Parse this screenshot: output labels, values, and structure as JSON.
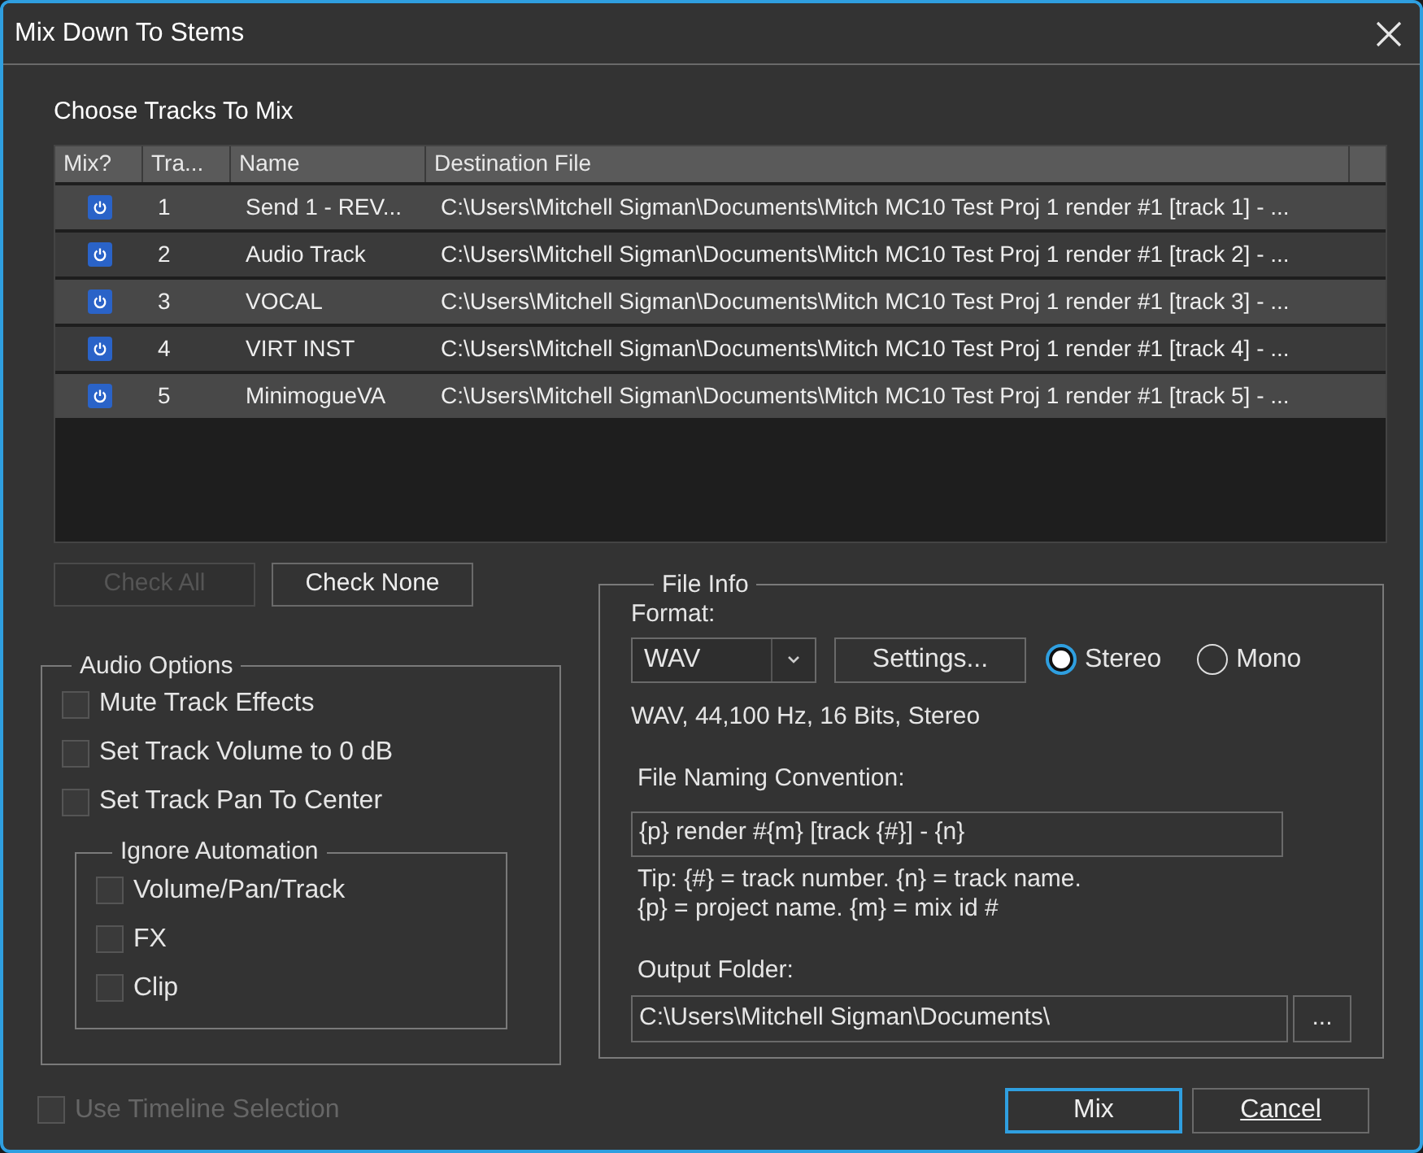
{
  "window": {
    "title": "Mix Down To Stems"
  },
  "tracks": {
    "title": "Choose Tracks To Mix",
    "columns": [
      "Mix?",
      "Tra...",
      "Name",
      "Destination File"
    ],
    "rows": [
      {
        "mix": true,
        "number": "1",
        "name": "Send 1 - REV...",
        "destination": "C:\\Users\\Mitchell Sigman\\Documents\\Mitch MC10 Test Proj 1 render #1 [track 1] - ..."
      },
      {
        "mix": true,
        "number": "2",
        "name": "Audio Track",
        "destination": "C:\\Users\\Mitchell Sigman\\Documents\\Mitch MC10 Test Proj 1 render #1 [track 2] - ..."
      },
      {
        "mix": true,
        "number": "3",
        "name": "VOCAL",
        "destination": "C:\\Users\\Mitchell Sigman\\Documents\\Mitch MC10 Test Proj 1 render #1 [track 3] - ..."
      },
      {
        "mix": true,
        "number": "4",
        "name": "VIRT INST",
        "destination": "C:\\Users\\Mitchell Sigman\\Documents\\Mitch MC10 Test Proj 1 render #1 [track 4] - ..."
      },
      {
        "mix": true,
        "number": "5",
        "name": "MinimogueVA",
        "destination": "C:\\Users\\Mitchell Sigman\\Documents\\Mitch MC10 Test Proj 1 render #1 [track 5] - ..."
      }
    ]
  },
  "check_buttons": [
    {
      "label": "Check All",
      "disabled": true
    },
    {
      "label": "Check None",
      "disabled": false
    }
  ],
  "audio_options": {
    "title": "Audio Options",
    "options": [
      {
        "label": "Mute Track Effects",
        "checked": false
      },
      {
        "label": "Set Track Volume to 0 dB",
        "checked": false
      },
      {
        "label": "Set Track Pan To Center",
        "checked": false
      }
    ],
    "ignore_automation": {
      "title": "Ignore Automation",
      "options": [
        {
          "label": "Volume/Pan/Track",
          "checked": false
        },
        {
          "label": "FX",
          "checked": false
        },
        {
          "label": "Clip",
          "checked": false
        }
      ]
    }
  },
  "file_info": {
    "title": "File Info",
    "format_label": "Format:",
    "format": "WAV",
    "settings_button": "Settings...",
    "channels": [
      {
        "label": "Stereo",
        "selected": true
      },
      {
        "label": "Mono",
        "selected": false
      }
    ],
    "summary": "WAV, 44,100 Hz, 16 Bits, Stereo",
    "naming_label": "File Naming Convention:",
    "naming_value": "{p} render #{m} [track {#}] - {n}",
    "tip_lines": [
      "Tip: {#} = track number. {n} = track name.",
      "{p} = project name. {m} = mix id #"
    ],
    "output_label": "Output Folder:",
    "output_value": "C:\\Users\\Mitchell Sigman\\Documents\\",
    "browse_button": "..."
  },
  "use_timeline_selection": {
    "label": "Use Timeline Selection",
    "checked": false,
    "disabled": true
  },
  "actions": [
    {
      "label": "Mix",
      "default": true
    },
    {
      "label": "Cancel",
      "default": false
    }
  ]
}
